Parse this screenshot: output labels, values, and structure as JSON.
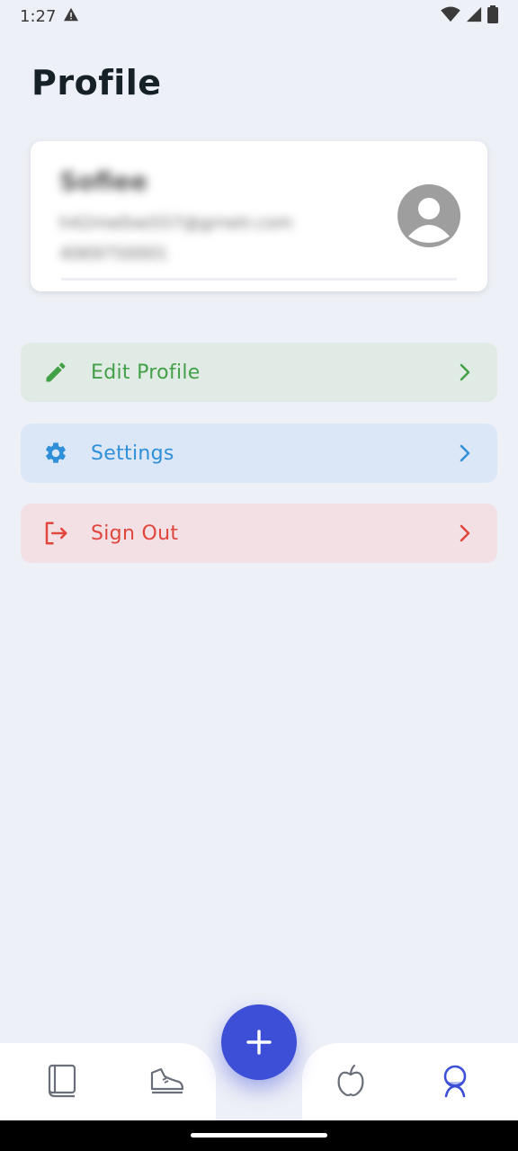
{
  "status_bar": {
    "time": "1:27"
  },
  "header": {
    "title": "Profile"
  },
  "profile": {
    "name": "Sofiee",
    "email": "h42me0xe557@grnetr.com",
    "phone": "4069750001"
  },
  "menu": [
    {
      "label": "Edit Profile",
      "icon": "pencil-icon",
      "color": "#43a047"
    },
    {
      "label": "Settings",
      "icon": "gear-icon",
      "color": "#2f8fd8"
    },
    {
      "label": "Sign Out",
      "icon": "logout-icon",
      "color": "#e0463c"
    }
  ],
  "bottom_nav": {
    "items": [
      "book-icon",
      "shoe-icon",
      "apple-icon",
      "profile-icon"
    ],
    "fab_icon": "plus-icon",
    "accent": "#3d4fd6"
  }
}
